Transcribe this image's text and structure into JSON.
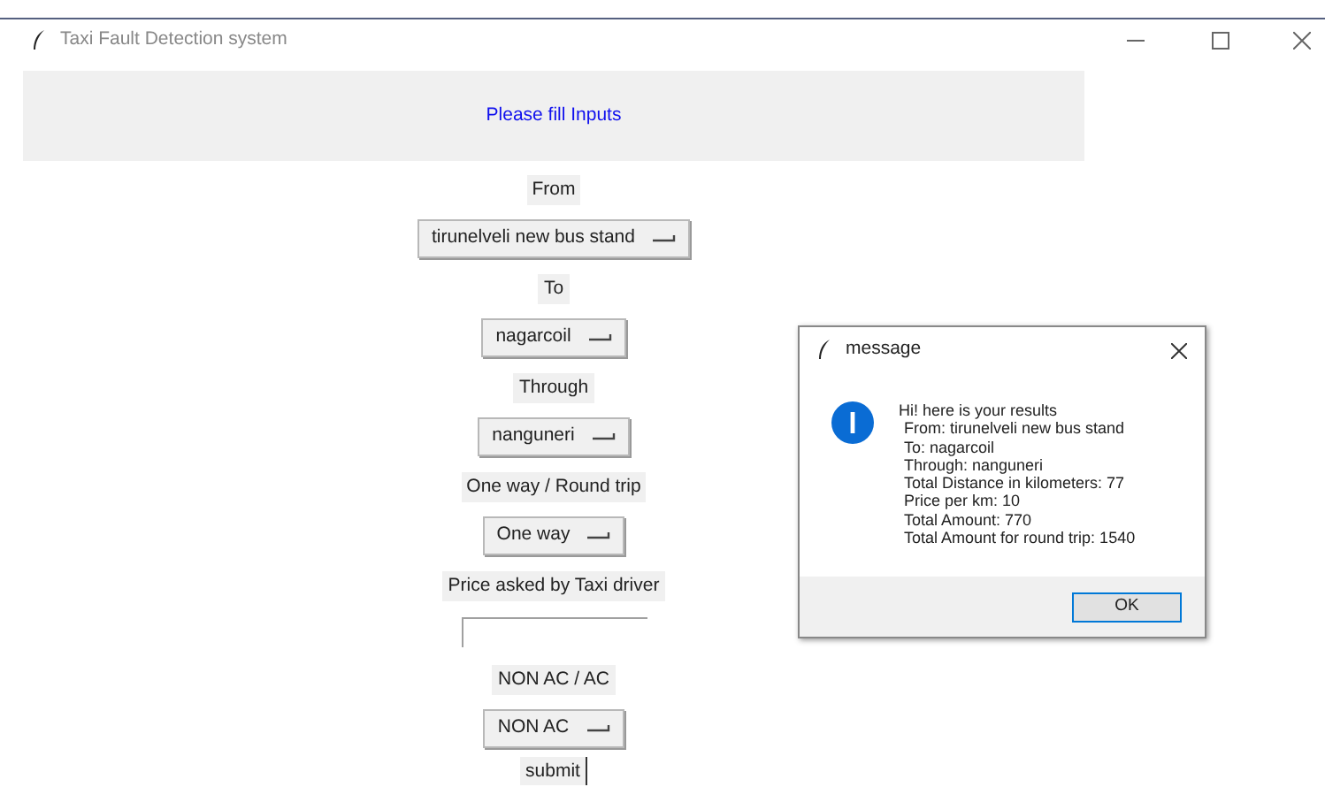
{
  "window": {
    "title": "Taxi Fault Detection system"
  },
  "header": {
    "text": "Please fill Inputs"
  },
  "form": [
    {
      "kind": "label",
      "text": "From"
    },
    {
      "kind": "dropdown",
      "value": "tirunelveli new bus stand"
    },
    {
      "kind": "label",
      "text": "To"
    },
    {
      "kind": "dropdown",
      "value": "nagarcoil"
    },
    {
      "kind": "label",
      "text": "Through"
    },
    {
      "kind": "dropdown",
      "value": "nanguneri"
    },
    {
      "kind": "label",
      "text": "One way / Round trip"
    },
    {
      "kind": "dropdown",
      "value": "One way"
    },
    {
      "kind": "label",
      "text": "Price asked by Taxi driver"
    },
    {
      "kind": "entry"
    },
    {
      "kind": "label",
      "text": "NON AC / AC"
    },
    {
      "kind": "dropdown",
      "value": "NON AC"
    },
    {
      "kind": "button",
      "text": "submit"
    }
  ],
  "dialog": {
    "title": "message",
    "lines": [
      "Hi! here is your results",
      "From: tirunelveli new bus stand",
      "To: nagarcoil",
      "Through: nanguneri",
      "Total Distance in kilometers: 77",
      "Price per km: 10",
      "Total Amount: 770",
      "Total Amount for round trip: 1540"
    ],
    "button": "OK"
  }
}
